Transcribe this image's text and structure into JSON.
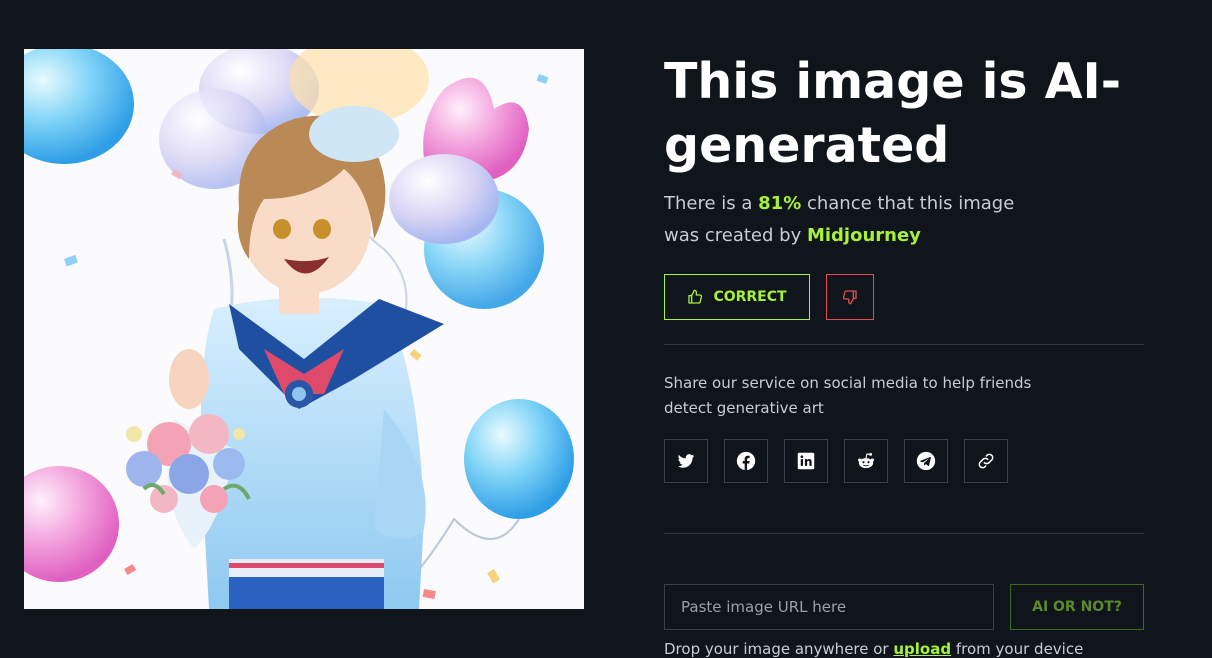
{
  "result": {
    "headline": "This image is AI-generated",
    "prefix": "There is a ",
    "percent": "81%",
    "middle": " chance that this image was created by ",
    "model": "Midjourney"
  },
  "feedback": {
    "correct_label": "CORRECT",
    "icons": {
      "correct": "thumbs-up-icon",
      "wrong": "thumbs-down-icon"
    },
    "colors": {
      "correct": "#a6f23a",
      "wrong": "#e24a55"
    }
  },
  "share": {
    "text": "Share our service on social media to help friends detect generative art",
    "icons": [
      "twitter-icon",
      "facebook-icon",
      "linkedin-icon",
      "reddit-icon",
      "telegram-icon",
      "link-icon"
    ]
  },
  "checker": {
    "placeholder": "Paste image URL here",
    "button_label": "AI OR NOT?",
    "hint_prefix": "Drop your image anywhere or ",
    "hint_link": "upload",
    "hint_suffix": " from your device"
  },
  "theme": {
    "background": "#10141b",
    "accent": "#a6f23a"
  }
}
